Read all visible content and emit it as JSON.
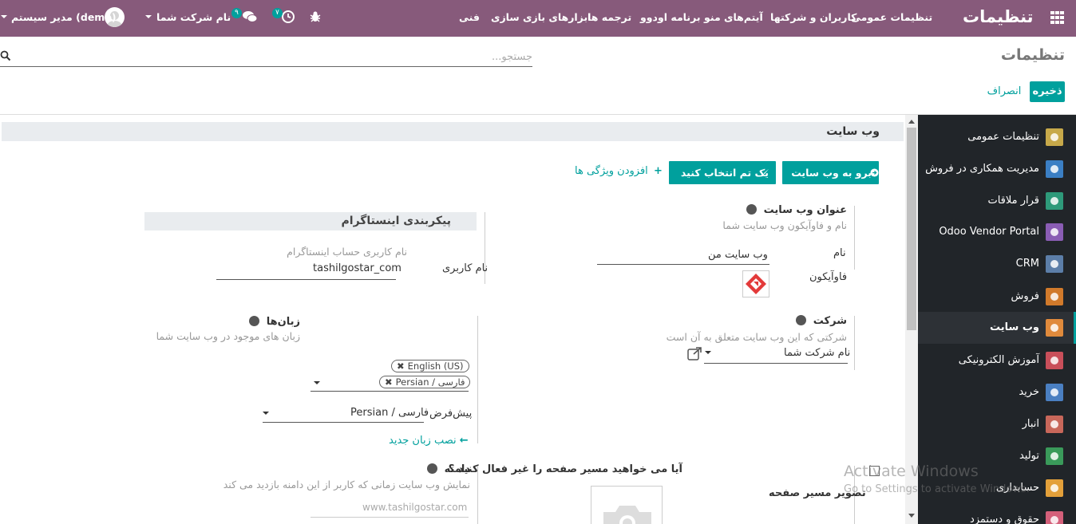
{
  "navbar": {
    "brand": "تنظیمات",
    "menu": [
      "تنظیمات عمومی",
      "کاربران و شرکتها",
      "آیتم‌های منو",
      "برنامه اودوو",
      "ترجمه ها",
      "ابزارهای بازی سازی",
      "فنی"
    ],
    "activity_count": "۷",
    "message_count": "۹",
    "company": "نام شرکت شما",
    "user": "مدیر سیستم (demo)"
  },
  "control_panel": {
    "title": "تنظیمات",
    "search_placeholder": "جستجو...",
    "save": "ذخیره",
    "discard": "انصراف"
  },
  "sidebar": [
    {
      "label": "تنظیمات عمومی",
      "icon": "gear-icon",
      "color": "#c7a94a"
    },
    {
      "label": "مدیریت همکاری در فروش",
      "icon": "network-icon",
      "color": "#3b7fc4"
    },
    {
      "label": "قرار ملاقات",
      "icon": "calendar-icon",
      "color": "#2e9a7a"
    },
    {
      "label": "Odoo Vendor Portal",
      "icon": "grid-icon",
      "color": "#8a5db4"
    },
    {
      "label": "CRM",
      "icon": "handshake-icon",
      "color": "#5c7ea8"
    },
    {
      "label": "فروش",
      "icon": "chart-icon",
      "color": "#d17a2b"
    },
    {
      "label": "وب سایت",
      "icon": "globe-icon",
      "color": "#e08a3c"
    },
    {
      "label": "آموزش الکترونیکی",
      "icon": "elearning-icon",
      "color": "#c94f5a"
    },
    {
      "label": "خرید",
      "icon": "credit-card-icon",
      "color": "#4a7fc1"
    },
    {
      "label": "انبار",
      "icon": "box-icon",
      "color": "#c8675a"
    },
    {
      "label": "تولید",
      "icon": "wrench-icon",
      "color": "#3a9a5a"
    },
    {
      "label": "حسابداری",
      "icon": "invoice-icon",
      "color": "#e3a03a"
    },
    {
      "label": "حقوق و دستمزد",
      "icon": "payroll-icon",
      "color": "#d4607a"
    }
  ],
  "website": {
    "section_title": "وب سایت",
    "btn_goto": "برو به وب سایت",
    "btn_theme": "یک تم انتخاب کنید",
    "link_features": "افزودن ویژگی ها",
    "site_title": "عنوان وب سایت",
    "site_title_desc": "نام و فاوآیکون وب سایت شما",
    "name_label": "نام",
    "name_value": "وب سایت من",
    "favicon_label": "فاوآیکون",
    "insta_title": "پیکربندی اینستاگرام",
    "insta_desc": "نام کاربری حساب اینستاگرام",
    "insta_user_label": "نام کاربری",
    "insta_user_value": "tashilgostar_com",
    "company_title": "شرکت",
    "company_desc": "شرکتی که این وب سایت متعلق به آن است",
    "company_value": "نام شرکت شما",
    "languages_title": "زبان‌ها",
    "languages_desc": "زبان های موجود در وب سایت شما",
    "language_tags": [
      "English (US)",
      "Persian / فارسی"
    ],
    "default_label": "پیش‌فرض",
    "default_value": "Persian / فارسی",
    "install_language": "نصب زبان جدید",
    "redirect_title": "آیا می خواهید مسیر صفحه را غیر فعال کنید ؟",
    "redirect_image": "تصویر مسیر صفحه",
    "domain_title": "دامنه",
    "domain_desc": "نمایش وب سایت زمانی که کاربر از این دامنه بازدید می کند",
    "domain_placeholder": "www.tashilgostar.com"
  },
  "os_watermark": {
    "title": "Activate Windows",
    "subtitle": "Go to Settings to activate Windows."
  }
}
